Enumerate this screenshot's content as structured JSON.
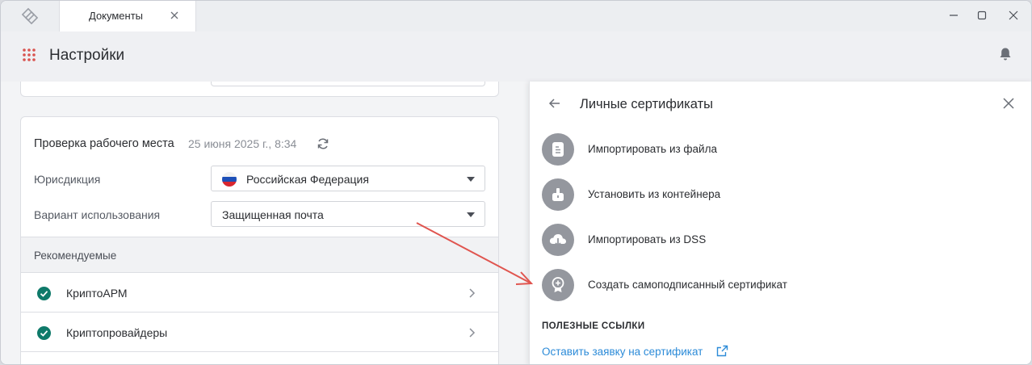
{
  "tabbar": {
    "tab_label": "Документы"
  },
  "header": {
    "title": "Настройки"
  },
  "workplace": {
    "title": "Проверка рабочего места",
    "date": "25 июня 2025 г., 8:34",
    "jurisdiction_label": "Юрисдикция",
    "jurisdiction_value": "Российская Федерация",
    "usage_label": "Вариант использования",
    "usage_value": "Защищенная почта",
    "recommended_header": "Рекомендуемые",
    "items": [
      {
        "label": "КриптоАРМ",
        "status": "ok"
      },
      {
        "label": "Криптопровайдеры",
        "status": "ok"
      }
    ]
  },
  "panel": {
    "title": "Личные сертификаты",
    "actions": [
      {
        "label": "Импортировать из файла",
        "icon": "file-icon"
      },
      {
        "label": "Установить из контейнера",
        "icon": "token-icon"
      },
      {
        "label": "Импортировать из DSS",
        "icon": "cloud-download-icon"
      },
      {
        "label": "Создать самоподписанный сертификат",
        "icon": "certificate-icon"
      }
    ],
    "useful_links_header": "ПОЛЕЗНЫЕ ССЫЛКИ",
    "link_label": "Оставить заявку на сертификат"
  },
  "colors": {
    "accent": "#2c8bd8",
    "ok": "#0f7a6a",
    "arrow": "#e0554f",
    "icon_circle": "#94979e"
  }
}
